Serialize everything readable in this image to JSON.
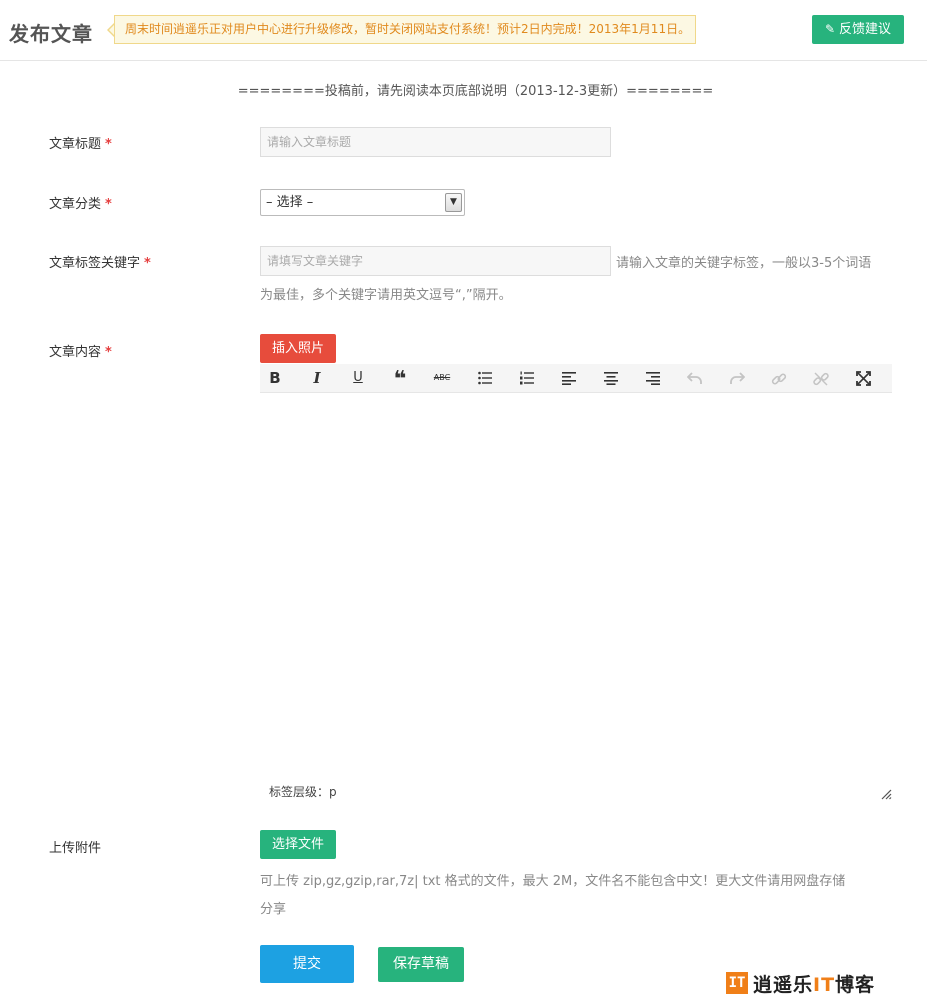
{
  "header": {
    "title": "发布文章",
    "notice": "周末时间逍遥乐正对用户中心进行升级修改，暂时关闭网站支付系统！预计2日内完成！2013年1月11日。",
    "feedback_label": "反馈建议"
  },
  "intro": "========投稿前，请先阅读本页底部说明（2013-12-3更新）========",
  "form": {
    "title": {
      "label": "文章标题",
      "required": "*",
      "placeholder": "请输入文章标题"
    },
    "category": {
      "label": "文章分类",
      "required": "*",
      "selected": "– 选择 –"
    },
    "keywords": {
      "label": "文章标签关键字",
      "required": "*",
      "placeholder": "请填写文章关键字",
      "hint_line1": "请输入文章的关键字标签，一般以3-5个词语",
      "hint_line2": "为最佳，多个关键字请用英文逗号“,”隔开。"
    },
    "content": {
      "label": "文章内容",
      "required": "*",
      "insert_photo_label": "插入照片",
      "tag_path": "标签层级：p"
    },
    "attachment": {
      "label": "上传附件",
      "choose_file_label": "选择文件",
      "hint_line1": "可上传 zip,gz,gzip,rar,7z| txt 格式的文件，最大 2M，文件名不能包含中文！更大文件请用网盘存储",
      "hint_line2": "分享"
    },
    "submit_label": "提交",
    "save_draft_label": "保存草稿"
  },
  "toolbar": [
    {
      "icon": "bold-icon",
      "glyph": "B"
    },
    {
      "icon": "italic-icon",
      "glyph": "I"
    },
    {
      "icon": "underline-icon",
      "glyph": "U"
    },
    {
      "icon": "blockquote-icon",
      "glyph": "❝"
    },
    {
      "icon": "strikethrough-icon",
      "glyph": "ABC"
    },
    {
      "icon": "bullet-list-icon"
    },
    {
      "icon": "numbered-list-icon"
    },
    {
      "icon": "align-left-icon"
    },
    {
      "icon": "align-center-icon"
    },
    {
      "icon": "align-right-icon"
    },
    {
      "icon": "undo-icon",
      "disabled": true
    },
    {
      "icon": "redo-icon",
      "disabled": true
    },
    {
      "icon": "link-icon",
      "disabled": true
    },
    {
      "icon": "unlink-icon",
      "disabled": true
    },
    {
      "icon": "fullscreen-icon"
    }
  ],
  "watermark": {
    "logo": "IT",
    "text_a": "逍遥乐",
    "text_it": "IT",
    "text_b": "博客"
  },
  "colors": {
    "green": "#27b37d",
    "red": "#e74c3c",
    "blue": "#1da1e2",
    "notice_bg": "#fcf8e3",
    "notice_text": "#e08a1e",
    "watermark_orange": "#f07f18"
  }
}
